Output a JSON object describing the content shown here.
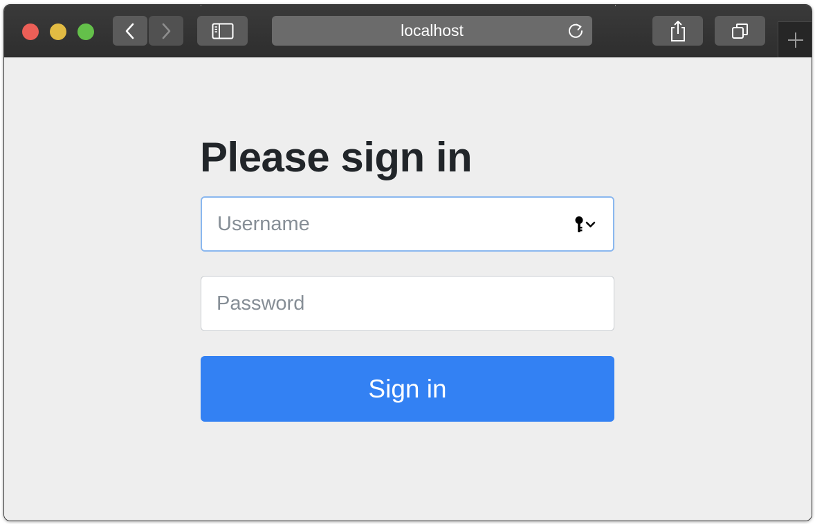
{
  "browser": {
    "url": "localhost",
    "icons": {
      "back": "chevron-left-icon",
      "forward": "chevron-right-icon",
      "sidebar": "sidebar-icon",
      "reload": "reload-icon",
      "share": "share-icon",
      "tabs": "tabs-overview-icon",
      "new_tab": "plus-icon"
    }
  },
  "form": {
    "title": "Please sign in",
    "username": {
      "value": "",
      "placeholder": "Username"
    },
    "password": {
      "value": "",
      "placeholder": "Password"
    },
    "submit_label": "Sign in"
  },
  "colors": {
    "primary": "#3381f3",
    "focus_border": "#8ab7ef",
    "page_background": "#eeeeee",
    "title_text": "#212529"
  }
}
